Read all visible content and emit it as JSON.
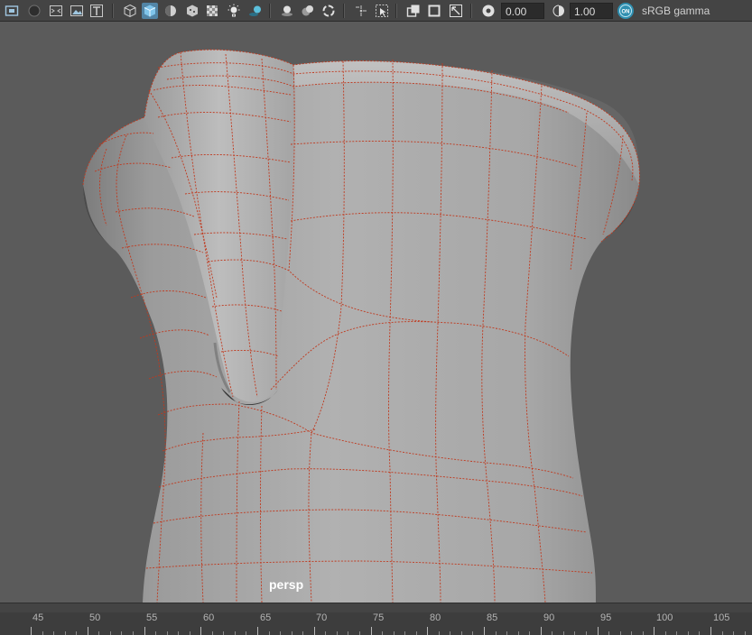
{
  "toolbar": {
    "exposure_value": "0.00",
    "gamma_value": "1.00",
    "color_space": "sRGB gamma",
    "icons": [
      "select-camera-icon",
      "camera-attributes-icon",
      "bookmark-icon",
      "image-plane-icon",
      "2d-pan-zoom-icon",
      "wireframe-icon",
      "smooth-shade-icon",
      "default-material-icon",
      "textured-icon",
      "xray-icon",
      "use-all-lights-icon",
      "shadows-icon",
      "ambient-occlusion-icon",
      "screen-space-ao-icon",
      "motion-blur-icon",
      "isolate-select-icon",
      "xray-joints-icon",
      "resolution-gate-icon",
      "gate-mask-icon",
      "field-chart-icon",
      "exposure-icon",
      "gamma-icon",
      "color-management-icon"
    ]
  },
  "viewport": {
    "camera_label": "persp",
    "wire_color": "#c0391e"
  },
  "timeline": {
    "ticks": [
      "45",
      "50",
      "55",
      "60",
      "65",
      "70",
      "75",
      "80",
      "85",
      "90",
      "95",
      "100",
      "105"
    ]
  }
}
